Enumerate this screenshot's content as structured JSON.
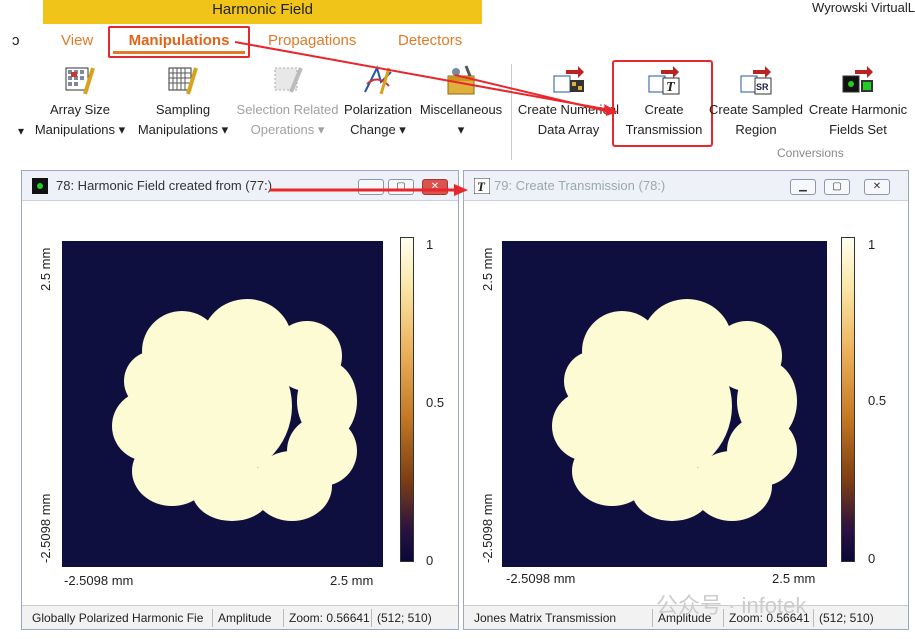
{
  "app": {
    "title": "Harmonic Field",
    "brand": "Wyrowski VirtualL"
  },
  "tabs": {
    "partial_left": "ɔ",
    "view": "View",
    "manipulations": "Manipulations",
    "propagations": "Propagations",
    "detectors": "Detectors"
  },
  "ribbon": {
    "array_size": [
      "Array Size",
      "Manipulations ▾"
    ],
    "sampling": [
      "Sampling",
      "Manipulations ▾"
    ],
    "selection": [
      "Selection Related",
      "Operations ▾"
    ],
    "polarization": [
      "Polarization",
      "Change ▾"
    ],
    "misc": [
      "Miscellaneous",
      "▾"
    ],
    "numerical": [
      "Create Numerical",
      "Data Array"
    ],
    "transmission": [
      "Create",
      "Transmission"
    ],
    "sampled": [
      "Create Sampled",
      "Region"
    ],
    "harmonic": [
      "Create Harmonic",
      "Fields Set"
    ],
    "group_label": "Conversions",
    "left_caret": "▾"
  },
  "window_left": {
    "title": "78: Harmonic Field created from (77:)",
    "y_top": "2.5 mm",
    "y_bottom": "-2.5098 mm",
    "x_left": "-2.5098 mm",
    "x_right": "2.5 mm",
    "cbar": [
      "1",
      "0.5",
      "0"
    ],
    "status": [
      "Globally Polarized Harmonic Fie",
      "Amplitude",
      "Zoom: 0.56641",
      "(512; 510)"
    ]
  },
  "window_right": {
    "title": "79: Create Transmission (78:)",
    "y_top": "2.5 mm",
    "y_bottom": "-2.5098 mm",
    "x_left": "-2.5098 mm",
    "x_right": "2.5 mm",
    "cbar": [
      "1",
      "0.5",
      "0"
    ],
    "status": [
      "Jones Matrix Transmission",
      "Amplitude",
      "Zoom: 0.56641",
      "(512; 510)"
    ]
  },
  "watermark": "公众号 · infotek",
  "colors": {
    "accent": "#e07b28",
    "highlight": "#e8262b",
    "plot_bg": "#0f0f3f",
    "shape": "#fdfbd3"
  }
}
